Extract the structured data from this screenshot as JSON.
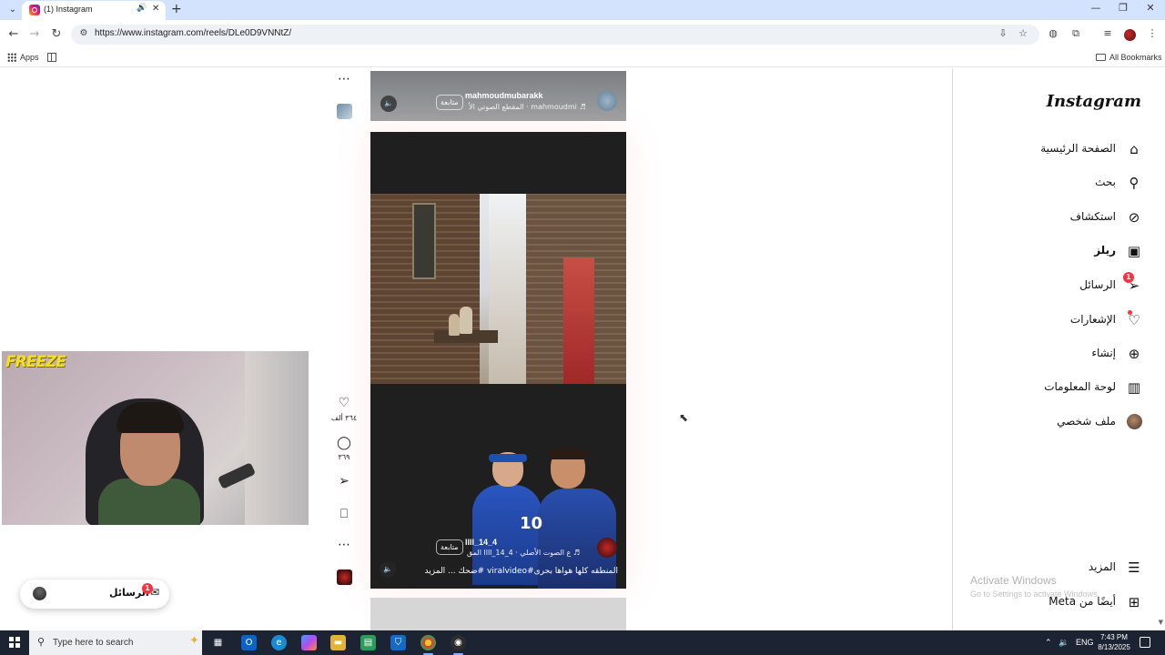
{
  "browser": {
    "tab_title": "(1) Instagram",
    "url": "https://www.instagram.com/reels/DLe0D9VNNtZ/",
    "bookmarks": {
      "apps_label": "Apps",
      "all_bookmarks_label": "All Bookmarks"
    }
  },
  "webcam": {
    "overlay_text": "FREEZE"
  },
  "messages_pill": {
    "label": "الرسائل",
    "badge": "1"
  },
  "reel_actions": {
    "likes": "٣٦٤ ألف",
    "comments": "٣٦٩"
  },
  "reels": {
    "top": {
      "username": "mahmoudmubarakk",
      "audio": "♬ mahmoudmi · المقطع الصوتي الأ",
      "follow_label": "متابعة"
    },
    "main": {
      "username": "llll_14_4",
      "audio": "♬ ع الصوت الأصلي · llll_14_4 المق",
      "follow_label": "متابعة",
      "caption": "المنطقه كلها هواها بحرى#viralvideo #ضحك ... المزيد",
      "poster_number": "10"
    }
  },
  "sidebar": {
    "logo": "Instagram",
    "items": [
      {
        "label": "الصفحة الرئيسية",
        "icon": "home-icon"
      },
      {
        "label": "بحث",
        "icon": "search-icon"
      },
      {
        "label": "استكشاف",
        "icon": "compass-icon"
      },
      {
        "label": "ريلز",
        "icon": "reels-icon"
      },
      {
        "label": "الرسائل",
        "icon": "messages-icon",
        "badge": "1"
      },
      {
        "label": "الإشعارات",
        "icon": "heart-icon"
      },
      {
        "label": "إنشاء",
        "icon": "plus-icon"
      },
      {
        "label": "لوحة المعلومات",
        "icon": "dashboard-icon"
      },
      {
        "label": "ملف شخصي",
        "icon": "profile-avatar"
      }
    ],
    "more_label": "المزيد",
    "meta_label": "أيضًا من Meta"
  },
  "watermark": {
    "title": "Activate Windows",
    "subtitle": "Go to Settings to activate Windows."
  },
  "taskbar": {
    "search_placeholder": "Type here to search",
    "language": "ENG",
    "time": "7:43 PM",
    "date": "8/13/2025"
  }
}
